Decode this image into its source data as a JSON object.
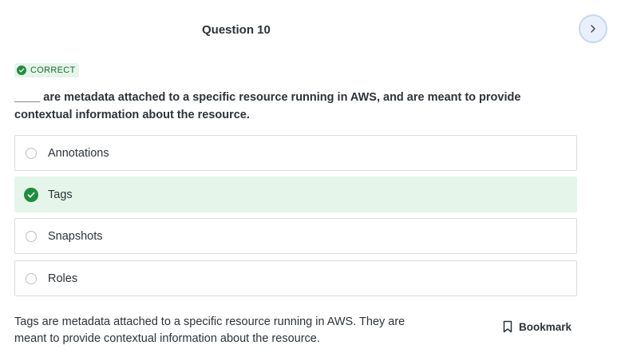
{
  "header": {
    "question_title": "Question 10"
  },
  "status": {
    "badge_label": "CORRECT",
    "color": "#1e8e3e"
  },
  "question": {
    "text": "____ are metadata attached to a specific resource running in AWS, and are meant to provide contextual information about the resource."
  },
  "options": [
    {
      "label": "Annotations",
      "state": "unselected"
    },
    {
      "label": "Tags",
      "state": "correct"
    },
    {
      "label": "Snapshots",
      "state": "unselected"
    },
    {
      "label": "Roles",
      "state": "unselected"
    }
  ],
  "explanation": {
    "text": "Tags are metadata attached to a specific resource running in AWS. They are meant to provide contextual information about the resource."
  },
  "actions": {
    "bookmark_label": "Bookmark",
    "next_icon": "chevron-right-icon"
  }
}
